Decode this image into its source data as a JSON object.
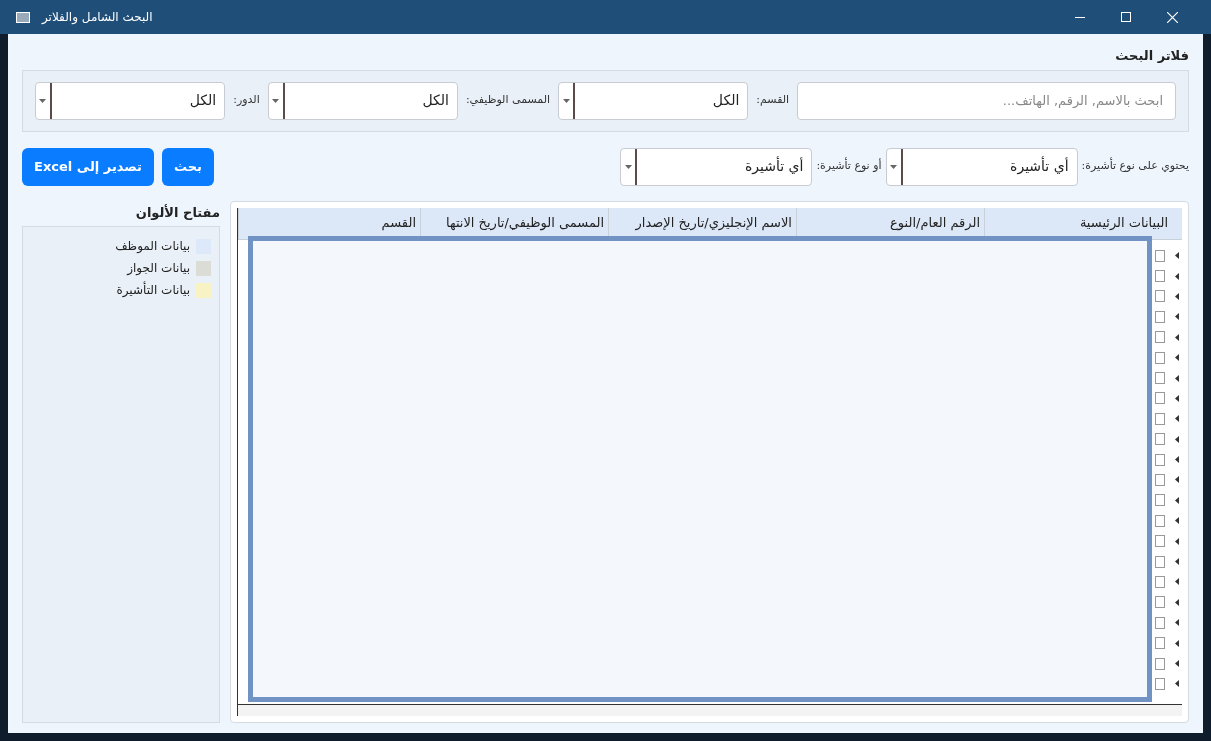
{
  "window": {
    "title": "البحث الشامل والفلاتر"
  },
  "filters": {
    "title": "فلاتر البحث",
    "search": {
      "placeholder": "ابحث بالاسم, الرقم, الهاتف..."
    },
    "combos": [
      {
        "label": "القسم:",
        "value": "الكل"
      },
      {
        "label": "المسمى الوظيفي:",
        "value": "الكل"
      },
      {
        "label": "الدور:",
        "value": "الكل"
      }
    ]
  },
  "visa_filters": [
    {
      "label": "يحتوي على نوع تأشيرة:",
      "value": "أي تأشيرة"
    },
    {
      "label": "أو نوع تأشيرة:",
      "value": "أي تأشيرة"
    }
  ],
  "buttons": [
    "بحث",
    "تصدير إلى Excel"
  ],
  "legend": {
    "title": "مفتاح الألوان",
    "items": [
      {
        "label": "بيانات الموظف",
        "color": "#dde9fa"
      },
      {
        "label": "بيانات الجواز",
        "color": "#dcdcd6"
      },
      {
        "label": "بيانات التأشيرة",
        "color": "#f7f3c4"
      }
    ]
  },
  "table": {
    "columns": [
      "البيانات الرئيسية",
      "الرقم العام/النوع",
      "الاسم الإنجليزي/تاريخ الإصدار",
      "المسمى الوظيفي/تاريخ الانتها",
      "القسم"
    ]
  }
}
